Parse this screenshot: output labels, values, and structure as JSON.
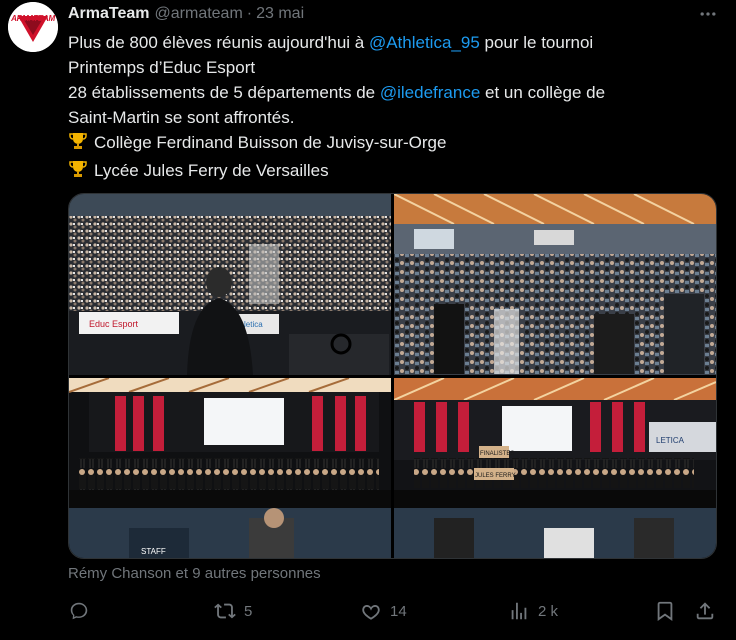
{
  "author": {
    "display_name": "ArmaTeam",
    "handle": "@armateam",
    "separator": "·",
    "time": "23 mai",
    "avatar_text": "ARMATEAM"
  },
  "tweet": {
    "line1_a": "Plus de 800 élèves réunis aujourd'hui à ",
    "mention1": "@Athletica_95",
    "line1_b": "  pour le tournoi",
    "line2": "Printemps d’Educ Esport",
    "line3_a": "28 établissements de 5 départements de ",
    "mention2": "@iledefrance",
    "line3_b": "  et un collège de",
    "line4": "Saint-Martin se sont affrontés.",
    "winner1": "Collège Ferdinand Buisson de Juvisy-sur-Orge",
    "winner2": "Lycée Jules Ferry de Versailles",
    "trophy_icon": "trophy-icon"
  },
  "media": {
    "photo1_banner_left": "Educ Esport",
    "photo1_banner_right": "Athletica",
    "photo3_sign": "STAFF",
    "photo4_sign1": "FINALISTES",
    "photo4_sign2": "JULES FERRY",
    "photo4_brand": "LETICA"
  },
  "likers": "Rémy Chanson et 9 autres personnes",
  "actions": {
    "reply_count": "",
    "retweet_count": "5",
    "like_count": "14",
    "views_count": "2 k"
  },
  "colors": {
    "background": "#000000",
    "text": "#e7e9ea",
    "secondary": "#71767b",
    "accent": "#1d9bf0"
  }
}
